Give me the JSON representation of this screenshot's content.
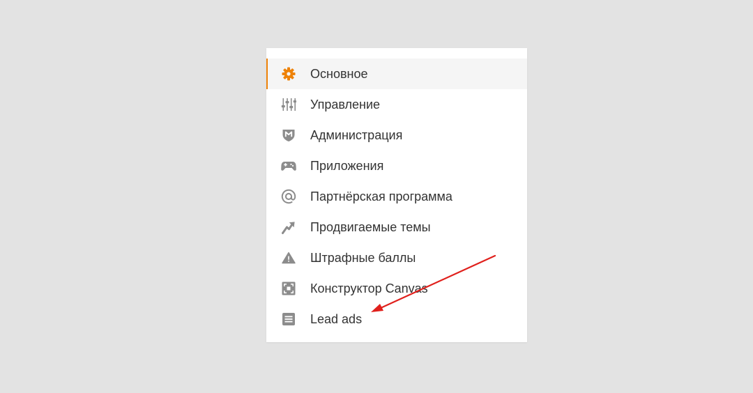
{
  "colors": {
    "background": "#e3e3e3",
    "panel": "#ffffff",
    "active_row": "#f5f5f5",
    "accent": "#ee8208",
    "icon_gray": "#8c8c8c",
    "text": "#333333",
    "annotation_arrow": "#e0201c"
  },
  "menu": {
    "items": [
      {
        "label": "Основное",
        "icon": "gear-icon",
        "active": true
      },
      {
        "label": "Управление",
        "icon": "sliders-icon",
        "active": false
      },
      {
        "label": "Администрация",
        "icon": "shield-icon",
        "active": false
      },
      {
        "label": "Приложения",
        "icon": "gamepad-icon",
        "active": false
      },
      {
        "label": "Партнёрская программа",
        "icon": "at-icon",
        "active": false
      },
      {
        "label": "Продвигаемые темы",
        "icon": "trend-arrow-icon",
        "active": false
      },
      {
        "label": "Штрафные баллы",
        "icon": "warning-icon",
        "active": false
      },
      {
        "label": "Конструктор Canvas",
        "icon": "canvas-icon",
        "active": false
      },
      {
        "label": "Lead ads",
        "icon": "form-list-icon",
        "active": false
      }
    ]
  },
  "annotation": {
    "icon": "red-arrow-icon",
    "points_to": "Lead ads"
  }
}
